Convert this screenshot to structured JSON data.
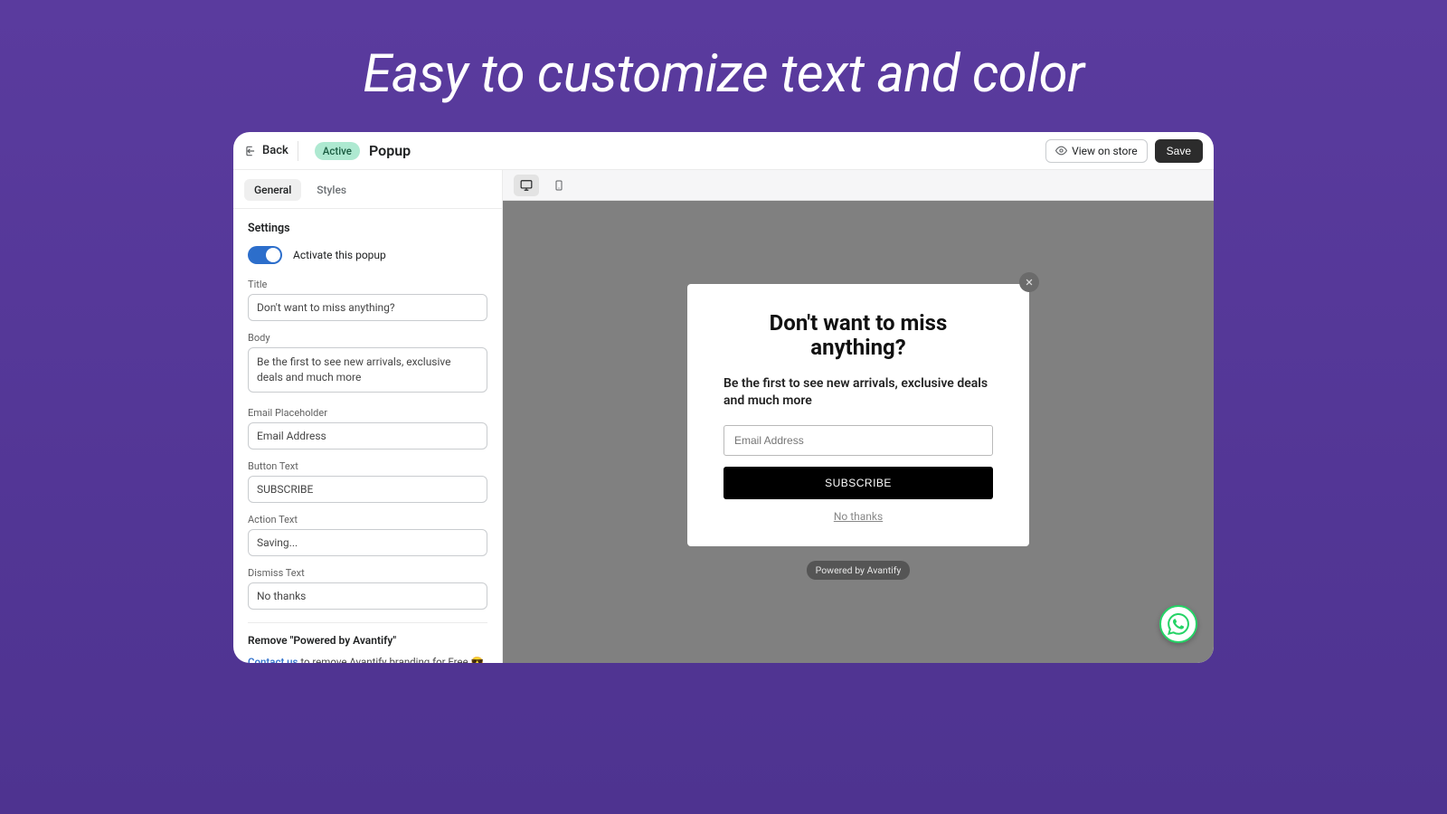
{
  "marketing_headline": "Easy to customize text and color",
  "topbar": {
    "back_label": "Back",
    "status": "Active",
    "page_title": "Popup",
    "view_on_store": "View on store",
    "save": "Save"
  },
  "tabs": {
    "general": "General",
    "styles": "Styles"
  },
  "settings": {
    "heading": "Settings",
    "activate_label": "Activate this popup",
    "activate_value": true,
    "title_label": "Title",
    "title_value": "Don't want to miss anything?",
    "body_label": "Body",
    "body_value": "Be the first to see new arrivals, exclusive deals and much more",
    "email_ph_label": "Email Placeholder",
    "email_ph_value": "Email Address",
    "button_text_label": "Button Text",
    "button_text_value": "SUBSCRIBE",
    "action_text_label": "Action Text",
    "action_text_value": "Saving...",
    "dismiss_text_label": "Dismiss Text",
    "dismiss_text_value": "No thanks"
  },
  "branding": {
    "heading": "Remove \"Powered by Avantify\"",
    "link_text": "Contact us",
    "rest_text": " to remove Avantify branding for Free 😎"
  },
  "preview": {
    "title": "Don't want to miss anything?",
    "body": "Be the first to see new arrivals, exclusive deals and much more",
    "email_placeholder": "Email Address",
    "subscribe": "SUBSCRIBE",
    "dismiss": "No thanks",
    "powered": "Powered by Avantify"
  }
}
